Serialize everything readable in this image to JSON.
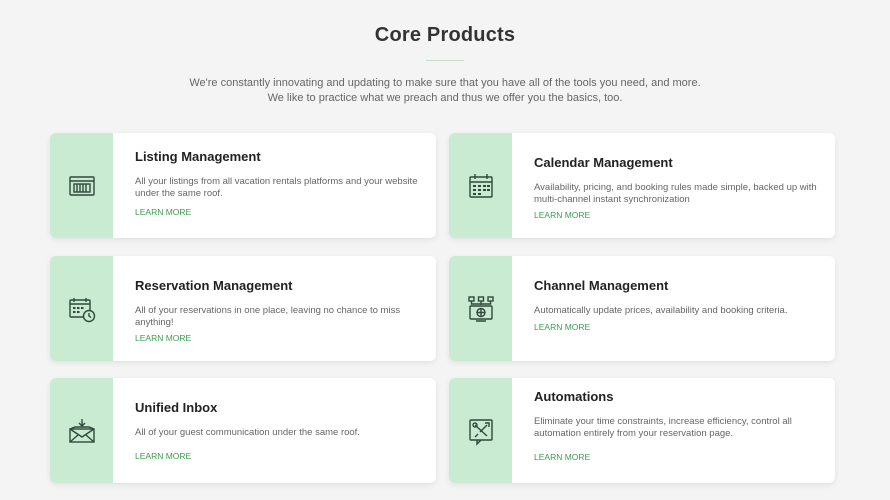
{
  "header": {
    "title": "Core Products",
    "intro_line1": "We're constantly innovating and updating to make sure that you have all of the tools you need, and more.",
    "intro_line2": "We like to practice what we preach and thus we offer you the basics, too."
  },
  "products": [
    {
      "name": "Listing Management",
      "description": "All your listings from all vacation rentals platforms and your website under the same roof.",
      "link": "LEARN MORE",
      "icon": "listing-icon"
    },
    {
      "name": "Calendar Management",
      "description": "Availability, pricing, and booking rules made simple, backed up with multi-channel instant synchronization",
      "link": "LEARN MORE",
      "icon": "calendar-icon"
    },
    {
      "name": "Reservation Management",
      "description": "All of your reservations in one place, leaving no chance to miss anything!",
      "link": "LEARN MORE",
      "icon": "calendar-clock-icon"
    },
    {
      "name": "Channel Management",
      "description": "Automatically update prices, availability and booking criteria.",
      "link": "LEARN MORE",
      "icon": "channel-network-icon"
    },
    {
      "name": "Unified Inbox",
      "description": "All of your guest communication under the same roof.",
      "link": "LEARN MORE",
      "icon": "inbox-envelope-icon"
    },
    {
      "name": "Automations",
      "description": "Eliminate your time constraints, increase efficiency, control all automation entirely from your reservation page.",
      "link": "LEARN MORE",
      "icon": "tools-icon"
    }
  ],
  "colors": {
    "background": "#f4f4f4",
    "icon_panel": "#c9ebd1",
    "accent_green": "#3f9a52",
    "icon_stroke": "#2f4a3a"
  }
}
